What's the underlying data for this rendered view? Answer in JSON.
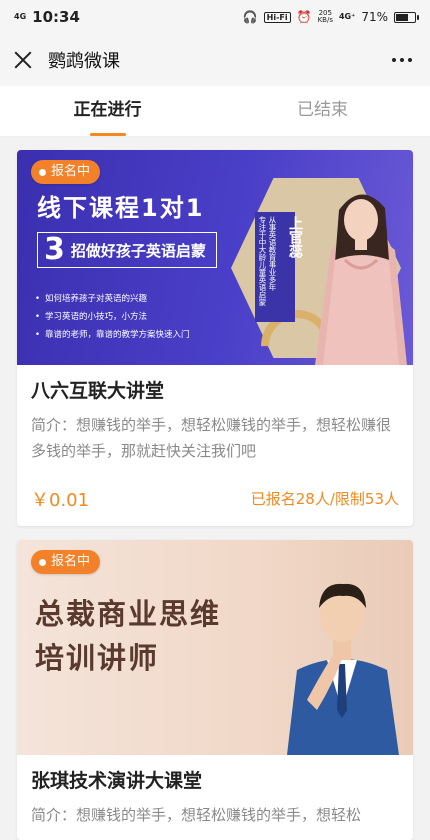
{
  "status_bar": {
    "network": "4G",
    "time": "10:34",
    "hifi": "Hi-Fi",
    "speed_value": "205",
    "speed_unit": "KB/s",
    "network2": "4G⁺",
    "battery": "71%",
    "battery_level": 0.71
  },
  "nav": {
    "title": "鹦鹉微课"
  },
  "tabs": [
    {
      "label": "正在进行",
      "active": true
    },
    {
      "label": "已结束",
      "active": false
    }
  ],
  "courses": [
    {
      "badge": "报名中",
      "banner": {
        "headline": "线下课程1对1",
        "number": "3",
        "subline": "招做好孩子英语启蒙",
        "bullets": [
          "如何培养孩子对英语的兴趣",
          "学习英语的小技巧，小方法",
          "靠谱的老师，靠谱的教学方案快速入门"
        ],
        "teacher_name": "上官蕊",
        "teacher_desc_1": "从事英语教育事业多年",
        "teacher_desc_2": "专注于中大龄儿童英语启蒙"
      },
      "title": "八六互联大讲堂",
      "description": "简介：想赚钱的举手，想轻松赚钱的举手，想轻松赚很多钱的举手，那就赶快关注我们吧",
      "price": "￥0.01",
      "enrollment": "已报名28人/限制53人"
    },
    {
      "badge": "报名中",
      "banner": {
        "line1": "总裁商业思维",
        "line2": "培训讲师"
      },
      "title": "张琪技术演讲大课堂",
      "description": "简介：想赚钱的举手，想轻松赚钱的举手，想轻松"
    }
  ]
}
